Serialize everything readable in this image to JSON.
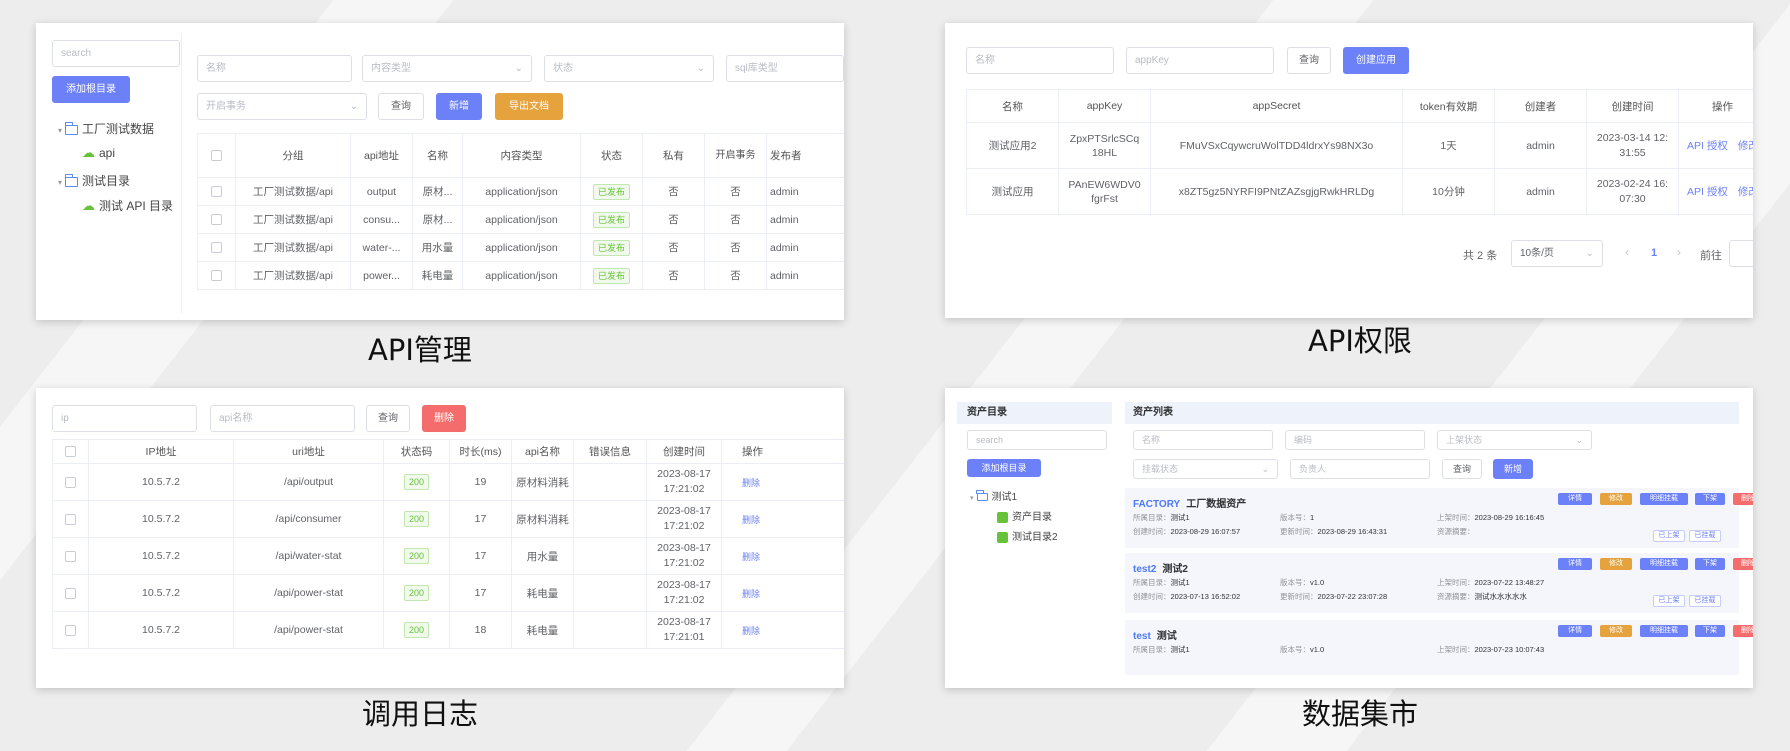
{
  "captions": {
    "api_management": "API管理",
    "api_permission": "API权限",
    "call_log": "调用日志",
    "data_market": "数据集市"
  },
  "api_mgmt": {
    "search_placeholder": "search",
    "add_root_button": "添加根目录",
    "tree": [
      {
        "label": "工厂测试数据",
        "type": "folder"
      },
      {
        "label": "api",
        "type": "api"
      },
      {
        "label": "测试目录",
        "type": "folder"
      },
      {
        "label": "测试 API 目录",
        "type": "api"
      }
    ],
    "filters": {
      "name": "名称",
      "content_type": "内容类型",
      "status": "状态",
      "sql_type": "sql库类型",
      "transaction": "开启事务"
    },
    "buttons": {
      "query": "查询",
      "add": "新增",
      "export": "导出文档"
    },
    "columns": [
      "分组",
      "api地址",
      "名称",
      "内容类型",
      "状态",
      "私有",
      "开启事务",
      "发布者"
    ],
    "rows": [
      {
        "group": "工厂测试数据/api",
        "path": "output",
        "name": "原材...",
        "content_type": "application/json",
        "status": "已发布",
        "private": "否",
        "transaction": "否",
        "publisher": "admin"
      },
      {
        "group": "工厂测试数据/api",
        "path": "consu...",
        "name": "原材...",
        "content_type": "application/json",
        "status": "已发布",
        "private": "否",
        "transaction": "否",
        "publisher": "admin"
      },
      {
        "group": "工厂测试数据/api",
        "path": "water-...",
        "name": "用水量",
        "content_type": "application/json",
        "status": "已发布",
        "private": "否",
        "transaction": "否",
        "publisher": "admin"
      },
      {
        "group": "工厂测试数据/api",
        "path": "power...",
        "name": "耗电量",
        "content_type": "application/json",
        "status": "已发布",
        "private": "否",
        "transaction": "否",
        "publisher": "admin"
      }
    ]
  },
  "api_perm": {
    "filters": {
      "name": "名称",
      "appkey": "appKey"
    },
    "buttons": {
      "query": "查询",
      "create": "创建应用"
    },
    "columns": [
      "名称",
      "appKey",
      "appSecret",
      "token有效期",
      "创建者",
      "创建时间",
      "操作"
    ],
    "rows": [
      {
        "name": "测试应用2",
        "appkey1": "ZpxPTSrlcSCq",
        "appkey2": "18HL",
        "secret": "FMuVSxCqywcruWolTDD4ldrxYs98NX3o",
        "token": "1天",
        "creator": "admin",
        "time1": "2023-03-14 12:",
        "time2": "31:55",
        "op_auth": "API 授权",
        "op_edit": "修改"
      },
      {
        "name": "测试应用",
        "appkey1": "PAnEW6WDV0",
        "appkey2": "fgrFst",
        "secret": "x8ZT5gz5NYRFI9PNtZAZsgjgRwkHRLDg",
        "token": "10分钟",
        "creator": "admin",
        "time1": "2023-02-24 16:",
        "time2": "07:30",
        "op_auth": "API 授权",
        "op_edit": "修改"
      }
    ],
    "pagination": {
      "total": "共 2 条",
      "page_size": "10条/页",
      "current": "1",
      "goto": "前往"
    }
  },
  "call_log": {
    "filters": {
      "ip": "ip",
      "api_name": "api名称"
    },
    "buttons": {
      "query": "查询",
      "delete": "删除"
    },
    "columns": [
      "IP地址",
      "uri地址",
      "状态码",
      "时长(ms)",
      "api名称",
      "错误信息",
      "创建时间",
      "操作"
    ],
    "rows": [
      {
        "ip": "10.5.7.2",
        "uri": "/api/output",
        "code": "200",
        "duration": "19",
        "api": "原材料消耗",
        "error": "",
        "date": "2023-08-17",
        "time": "17:21:02",
        "op": "删除"
      },
      {
        "ip": "10.5.7.2",
        "uri": "/api/consumer",
        "code": "200",
        "duration": "17",
        "api": "原材料消耗",
        "error": "",
        "date": "2023-08-17",
        "time": "17:21:02",
        "op": "删除"
      },
      {
        "ip": "10.5.7.2",
        "uri": "/api/water-stat",
        "code": "200",
        "duration": "17",
        "api": "用水量",
        "error": "",
        "date": "2023-08-17",
        "time": "17:21:02",
        "op": "删除"
      },
      {
        "ip": "10.5.7.2",
        "uri": "/api/power-stat",
        "code": "200",
        "duration": "17",
        "api": "耗电量",
        "error": "",
        "date": "2023-08-17",
        "time": "17:21:02",
        "op": "删除"
      },
      {
        "ip": "10.5.7.2",
        "uri": "/api/power-stat",
        "code": "200",
        "duration": "18",
        "api": "耗电量",
        "error": "",
        "date": "2023-08-17",
        "time": "17:21:01",
        "op": "删除"
      }
    ]
  },
  "market": {
    "left_title": "资产目录",
    "right_title": "资产列表",
    "search_placeholder": "search",
    "add_root_button": "添加根目录",
    "tree": [
      {
        "label": "测试1",
        "type": "folder"
      },
      {
        "label": "资产目录",
        "type": "db"
      },
      {
        "label": "测试目录2",
        "type": "db"
      }
    ],
    "filters": {
      "name": "名称",
      "code": "编码",
      "shelf": "上架状态",
      "mount": "挂载状态",
      "owner": "负责人"
    },
    "buttons": {
      "query": "查询",
      "add": "新增"
    },
    "card_buttons": [
      "详情",
      "修改",
      "明细挂载",
      "下架",
      "删除"
    ],
    "meta_labels": {
      "catalog": "所属目录：",
      "version": "版本号：",
      "shelf_time": "上架时间：",
      "created": "创建时间：",
      "updated": "更新时间：",
      "summary": "资源摘要："
    },
    "cards": [
      {
        "code": "FACTORY",
        "name": "工厂数据资产",
        "catalog": "测试1",
        "version": "1",
        "shelf_time": "2023-08-29 16:16:45",
        "created": "2023-08-29 16:07:57",
        "updated": "2023-08-29 16:43:31",
        "summary": "",
        "tags": [
          "已上架",
          "已挂载"
        ]
      },
      {
        "code": "test2",
        "name": "测试2",
        "catalog": "测试1",
        "version": "v1.0",
        "shelf_time": "2023-07-22 13:48:27",
        "created": "2023-07-13 16:52:02",
        "updated": "2023-07-22 23:07:28",
        "summary": "测试水水水水水",
        "tags": [
          "已上架",
          "已挂载"
        ]
      },
      {
        "code": "test",
        "name": "测试",
        "catalog": "测试1",
        "version": "v1.0",
        "shelf_time": "2023-07-23 10:07:43"
      }
    ]
  },
  "colors": {
    "primary": "#6c80f7",
    "warning": "#e6a23c",
    "danger": "#f56c6c",
    "success": "#67c23a"
  }
}
